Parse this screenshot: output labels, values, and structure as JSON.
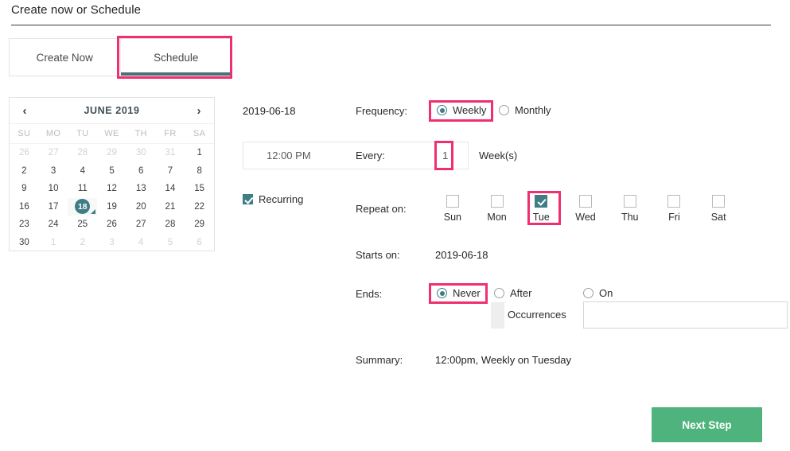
{
  "header": {
    "title": "Create now or Schedule"
  },
  "tabs": [
    {
      "label": "Create Now",
      "active": false
    },
    {
      "label": "Schedule",
      "active": true
    }
  ],
  "calendar": {
    "prev_icon": "‹",
    "next_icon": "›",
    "month_title": "JUNE 2019",
    "weekdays": [
      "SU",
      "MO",
      "TU",
      "WE",
      "TH",
      "FR",
      "SA"
    ],
    "weeks": [
      [
        {
          "d": "26",
          "muted": true
        },
        {
          "d": "27",
          "muted": true
        },
        {
          "d": "28",
          "muted": true
        },
        {
          "d": "29",
          "muted": true
        },
        {
          "d": "30",
          "muted": true
        },
        {
          "d": "31",
          "muted": true
        },
        {
          "d": "1",
          "muted": false
        }
      ],
      [
        {
          "d": "2",
          "muted": false
        },
        {
          "d": "3",
          "muted": false
        },
        {
          "d": "4",
          "muted": false
        },
        {
          "d": "5",
          "muted": false
        },
        {
          "d": "6",
          "muted": false
        },
        {
          "d": "7",
          "muted": false
        },
        {
          "d": "8",
          "muted": false
        }
      ],
      [
        {
          "d": "9",
          "muted": false
        },
        {
          "d": "10",
          "muted": false
        },
        {
          "d": "11",
          "muted": false
        },
        {
          "d": "12",
          "muted": false
        },
        {
          "d": "13",
          "muted": false
        },
        {
          "d": "14",
          "muted": false
        },
        {
          "d": "15",
          "muted": false
        }
      ],
      [
        {
          "d": "16",
          "muted": false
        },
        {
          "d": "17",
          "muted": false
        },
        {
          "d": "18",
          "muted": false,
          "selected": true
        },
        {
          "d": "19",
          "muted": false
        },
        {
          "d": "20",
          "muted": false
        },
        {
          "d": "21",
          "muted": false
        },
        {
          "d": "22",
          "muted": false
        }
      ],
      [
        {
          "d": "23",
          "muted": false
        },
        {
          "d": "24",
          "muted": false
        },
        {
          "d": "25",
          "muted": false
        },
        {
          "d": "26",
          "muted": false
        },
        {
          "d": "27",
          "muted": false
        },
        {
          "d": "28",
          "muted": false
        },
        {
          "d": "29",
          "muted": false
        }
      ],
      [
        {
          "d": "30",
          "muted": false
        },
        {
          "d": "1",
          "muted": true
        },
        {
          "d": "2",
          "muted": true
        },
        {
          "d": "3",
          "muted": true
        },
        {
          "d": "4",
          "muted": true
        },
        {
          "d": "5",
          "muted": true
        },
        {
          "d": "6",
          "muted": true
        }
      ]
    ]
  },
  "form": {
    "date_text": "2019-06-18",
    "frequency_label": "Frequency:",
    "frequency_options": [
      {
        "label": "Weekly",
        "selected": true
      },
      {
        "label": "Monthly",
        "selected": false
      }
    ],
    "time_value": "12:00 PM",
    "every_label": "Every:",
    "every_count": "1",
    "unit_label": "Week(s)",
    "recurring_label": "Recurring",
    "recurring_checked": true,
    "repeat_label": "Repeat on:",
    "days": [
      {
        "label": "Sun",
        "checked": false
      },
      {
        "label": "Mon",
        "checked": false
      },
      {
        "label": "Tue",
        "checked": true
      },
      {
        "label": "Wed",
        "checked": false
      },
      {
        "label": "Thu",
        "checked": false
      },
      {
        "label": "Fri",
        "checked": false
      },
      {
        "label": "Sat",
        "checked": false
      }
    ],
    "starts_on_label": "Starts on:",
    "starts_on_value": "2019-06-18",
    "ends_label": "Ends:",
    "ends_options": [
      {
        "label": "Never",
        "selected": true
      },
      {
        "label": "After",
        "selected": false
      },
      {
        "label": "On",
        "selected": false
      }
    ],
    "occurrences_label": "Occurrences",
    "occurrences_value": "",
    "on_date_value": "",
    "summary_label": "Summary:",
    "summary_value": "12:00pm, Weekly on Tuesday"
  },
  "footer": {
    "next_step_label": "Next Step"
  },
  "colors": {
    "accent_teal": "#3f7d86",
    "tab_underline": "#4d7078",
    "highlight_pink": "#f0306e",
    "primary_green": "#4fb37d"
  }
}
